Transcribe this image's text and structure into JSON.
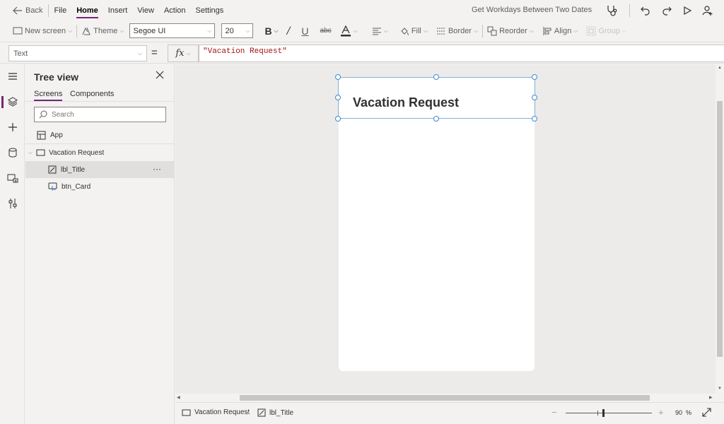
{
  "topbar": {
    "back_label": "Back",
    "menu": [
      "File",
      "Home",
      "Insert",
      "View",
      "Action",
      "Settings"
    ],
    "active_menu": "Home",
    "app_title": "Get Workdays Between Two Dates",
    "right_icons": [
      "app-checker-icon",
      "undo-icon",
      "redo-icon",
      "play-icon",
      "share-icon"
    ]
  },
  "toolbar": {
    "new_screen": "New screen",
    "theme": "Theme",
    "font": "Segoe UI",
    "font_size": "20",
    "fill": "Fill",
    "border": "Border",
    "reorder": "Reorder",
    "align": "Align",
    "group": "Group"
  },
  "formula": {
    "property": "Text",
    "equals": "=",
    "fx": "fx",
    "value": "\"Vacation Request\""
  },
  "tree": {
    "title": "Tree view",
    "tabs": [
      "Screens",
      "Components"
    ],
    "active_tab": "Screens",
    "search_placeholder": "Search",
    "app_label": "App",
    "screen_label": "Vacation Request",
    "controls": [
      "lbl_Title",
      "btn_Card"
    ],
    "selected_control": "lbl_Title",
    "more": "···"
  },
  "canvas": {
    "label_text": "Vacation Request"
  },
  "status": {
    "crumbs": [
      "Vacation Request",
      "lbl_Title"
    ],
    "zoom_minus": "−",
    "zoom_plus": "+",
    "zoom_value": "90",
    "zoom_unit": "%",
    "zoom_level": 0.43
  },
  "colors": {
    "accent": "#742774",
    "selection": "#3b8ad0",
    "formula_string": "#a31515"
  }
}
